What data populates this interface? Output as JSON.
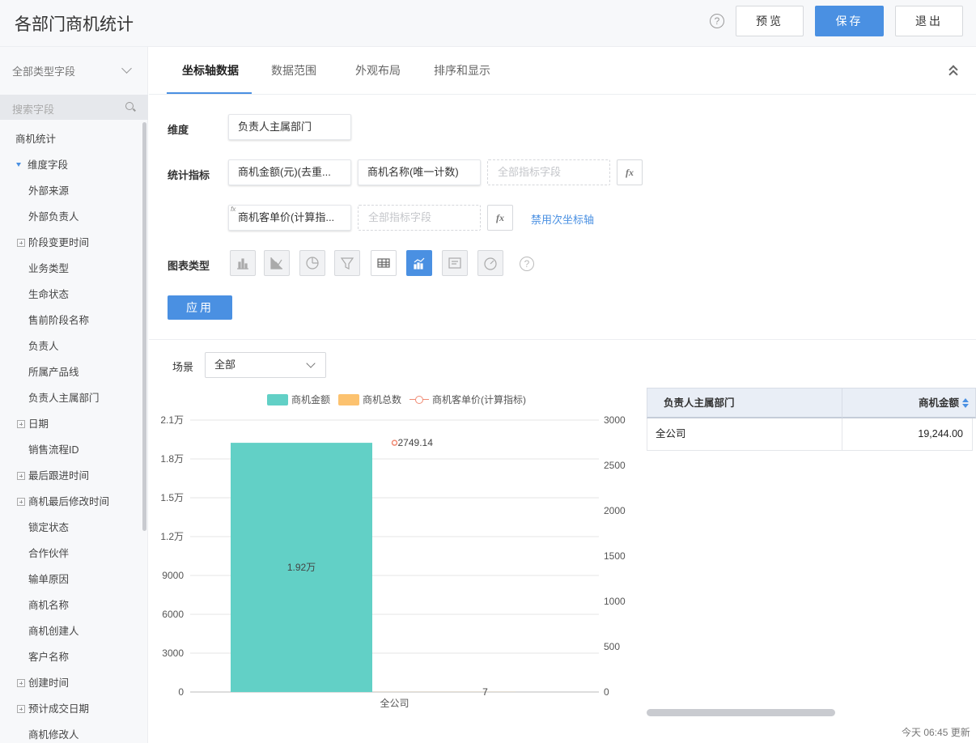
{
  "header": {
    "title": "各部门商机统计",
    "help_glyph": "?",
    "preview_label": "预览",
    "save_label": "保存",
    "exit_label": "退出"
  },
  "sidebar": {
    "type_select": "全部类型字段",
    "search_placeholder": "搜索字段",
    "items": [
      {
        "label": "商机统计",
        "kind": "root"
      },
      {
        "label": "维度字段",
        "kind": "open"
      },
      {
        "label": "外部来源",
        "kind": "leaf"
      },
      {
        "label": "外部负责人",
        "kind": "leaf"
      },
      {
        "label": "阶段变更时间",
        "kind": "group"
      },
      {
        "label": "业务类型",
        "kind": "leaf"
      },
      {
        "label": "生命状态",
        "kind": "leaf"
      },
      {
        "label": "售前阶段名称",
        "kind": "leaf"
      },
      {
        "label": "负责人",
        "kind": "leaf"
      },
      {
        "label": "所属产品线",
        "kind": "leaf"
      },
      {
        "label": "负责人主属部门",
        "kind": "leaf"
      },
      {
        "label": "日期",
        "kind": "group"
      },
      {
        "label": "销售流程ID",
        "kind": "leaf"
      },
      {
        "label": "最后跟进时间",
        "kind": "group"
      },
      {
        "label": "商机最后修改时间",
        "kind": "group"
      },
      {
        "label": "锁定状态",
        "kind": "leaf"
      },
      {
        "label": "合作伙伴",
        "kind": "leaf"
      },
      {
        "label": "输单原因",
        "kind": "leaf"
      },
      {
        "label": "商机名称",
        "kind": "leaf"
      },
      {
        "label": "商机创建人",
        "kind": "leaf"
      },
      {
        "label": "客户名称",
        "kind": "leaf"
      },
      {
        "label": "创建时间",
        "kind": "group"
      },
      {
        "label": "预计成交日期",
        "kind": "group"
      },
      {
        "label": "商机修改人",
        "kind": "leaf"
      }
    ]
  },
  "tabs": {
    "axis": "坐标轴数据",
    "range": "数据范围",
    "layout": "外观布局",
    "sort": "排序和显示"
  },
  "form": {
    "dimension_label": "维度",
    "dimension_value": "负责人主属部门",
    "metrics_label": "统计指标",
    "metric_1": "商机金额(元)(去重...",
    "metric_2": "商机名称(唯一计数)",
    "metric_placeholder": "全部指标字段",
    "fx_label": "fx",
    "fx_tag": "fx",
    "metric_3": "商机客单价(计算指...",
    "disable_secondary_axis": "禁用次坐标轴",
    "chart_type_label": "图表类型",
    "chart_types": [
      "bar-chart-icon",
      "line-chart-icon",
      "pie-chart-icon",
      "funnel-chart-icon",
      "table-chart-icon",
      "combo-chart-icon",
      "card-chart-icon",
      "gauge-chart-icon"
    ],
    "active_chart_type": "combo-chart-icon",
    "apply_label": "应用"
  },
  "scene": {
    "label": "场景",
    "value": "全部"
  },
  "chart_data": {
    "type": "bar",
    "categories": [
      "全公司"
    ],
    "series": [
      {
        "name": "商机金额",
        "type": "bar",
        "axis": "left",
        "values": [
          19244
        ],
        "color": "#62d0c6",
        "label": "1.92万"
      },
      {
        "name": "商机总数",
        "type": "bar",
        "axis": "left",
        "values": [
          7
        ],
        "color": "#fcc26f",
        "label": "7"
      },
      {
        "name": "商机客单价(计算指标)",
        "type": "line",
        "axis": "right",
        "values": [
          2749.14
        ],
        "color": "#f08a73",
        "label": "2749.14"
      }
    ],
    "y_left": {
      "min": 0,
      "max": 21000,
      "ticks": [
        "0",
        "3000",
        "6000",
        "9000",
        "1.2万",
        "1.5万",
        "1.8万",
        "2.1万"
      ]
    },
    "y_right": {
      "min": 0,
      "max": 3000,
      "ticks": [
        "0",
        "500",
        "1000",
        "1500",
        "2000",
        "2500",
        "3000"
      ]
    },
    "grid": true,
    "legend": "top"
  },
  "table": {
    "col_dept": "负责人主属部门",
    "col_amount": "商机金额",
    "rows": [
      {
        "dept": "全公司",
        "amount": "19,244.00"
      }
    ]
  },
  "footer": {
    "updated": "今天 06:45 更新"
  },
  "colors": {
    "primary": "#4a90e2",
    "bar_amount": "#62d0c6",
    "bar_count": "#fcc26f",
    "line_price": "#f08a73"
  }
}
